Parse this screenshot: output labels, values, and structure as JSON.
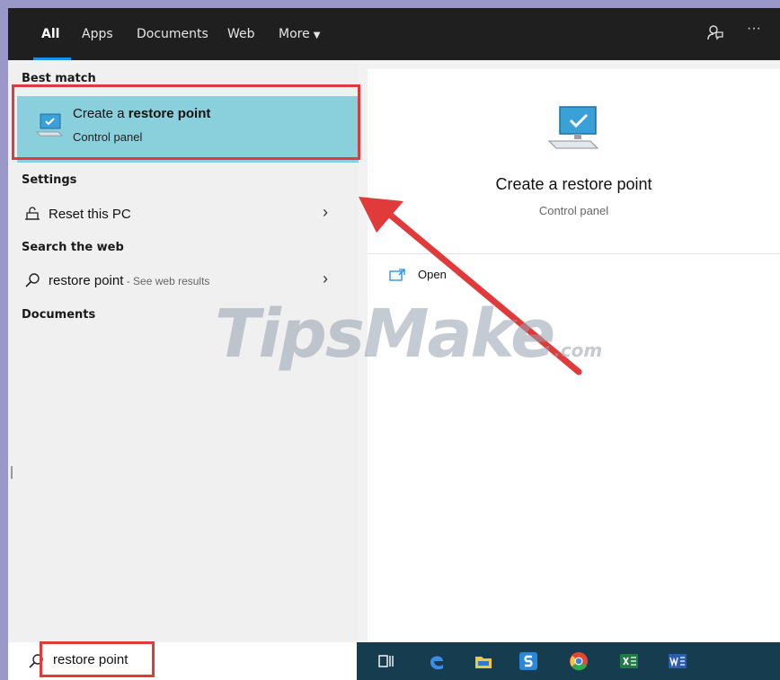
{
  "tabs": [
    {
      "label": "All"
    },
    {
      "label": "Apps"
    },
    {
      "label": "Documents"
    },
    {
      "label": "Web"
    },
    {
      "label": "More"
    }
  ],
  "top_icons": [
    "feedback-icon",
    "more-options-icon"
  ],
  "left": {
    "best_match_header": "Best match",
    "best_match": {
      "title_prefix": "Create a ",
      "title_bold": "restore point",
      "subtitle": "Control panel",
      "icon": "monitor-check-icon"
    },
    "settings_header": "Settings",
    "settings_item": {
      "label": "Reset this PC",
      "icon": "reset-pc-icon"
    },
    "web_header": "Search the web",
    "web_item": {
      "label": "restore point",
      "hint": " - See web results",
      "icon": "search-icon"
    },
    "documents_header": "Documents"
  },
  "preview": {
    "title": "Create a restore point",
    "subtitle": "Control panel",
    "open_label": "Open"
  },
  "watermark": {
    "text": "TipsMake",
    "suffix": ".com"
  },
  "search": {
    "value": "restore point"
  },
  "taskbar_icons": [
    "task-view-icon",
    "edge-icon",
    "file-explorer-icon",
    "snagit-icon",
    "chrome-icon",
    "excel-icon",
    "word-icon"
  ],
  "colors": {
    "accent_highlight": "#8ad0dc",
    "annotation_red": "#e03a3a",
    "taskbar": "#163c50",
    "tab_underline": "#1d8fe8"
  }
}
